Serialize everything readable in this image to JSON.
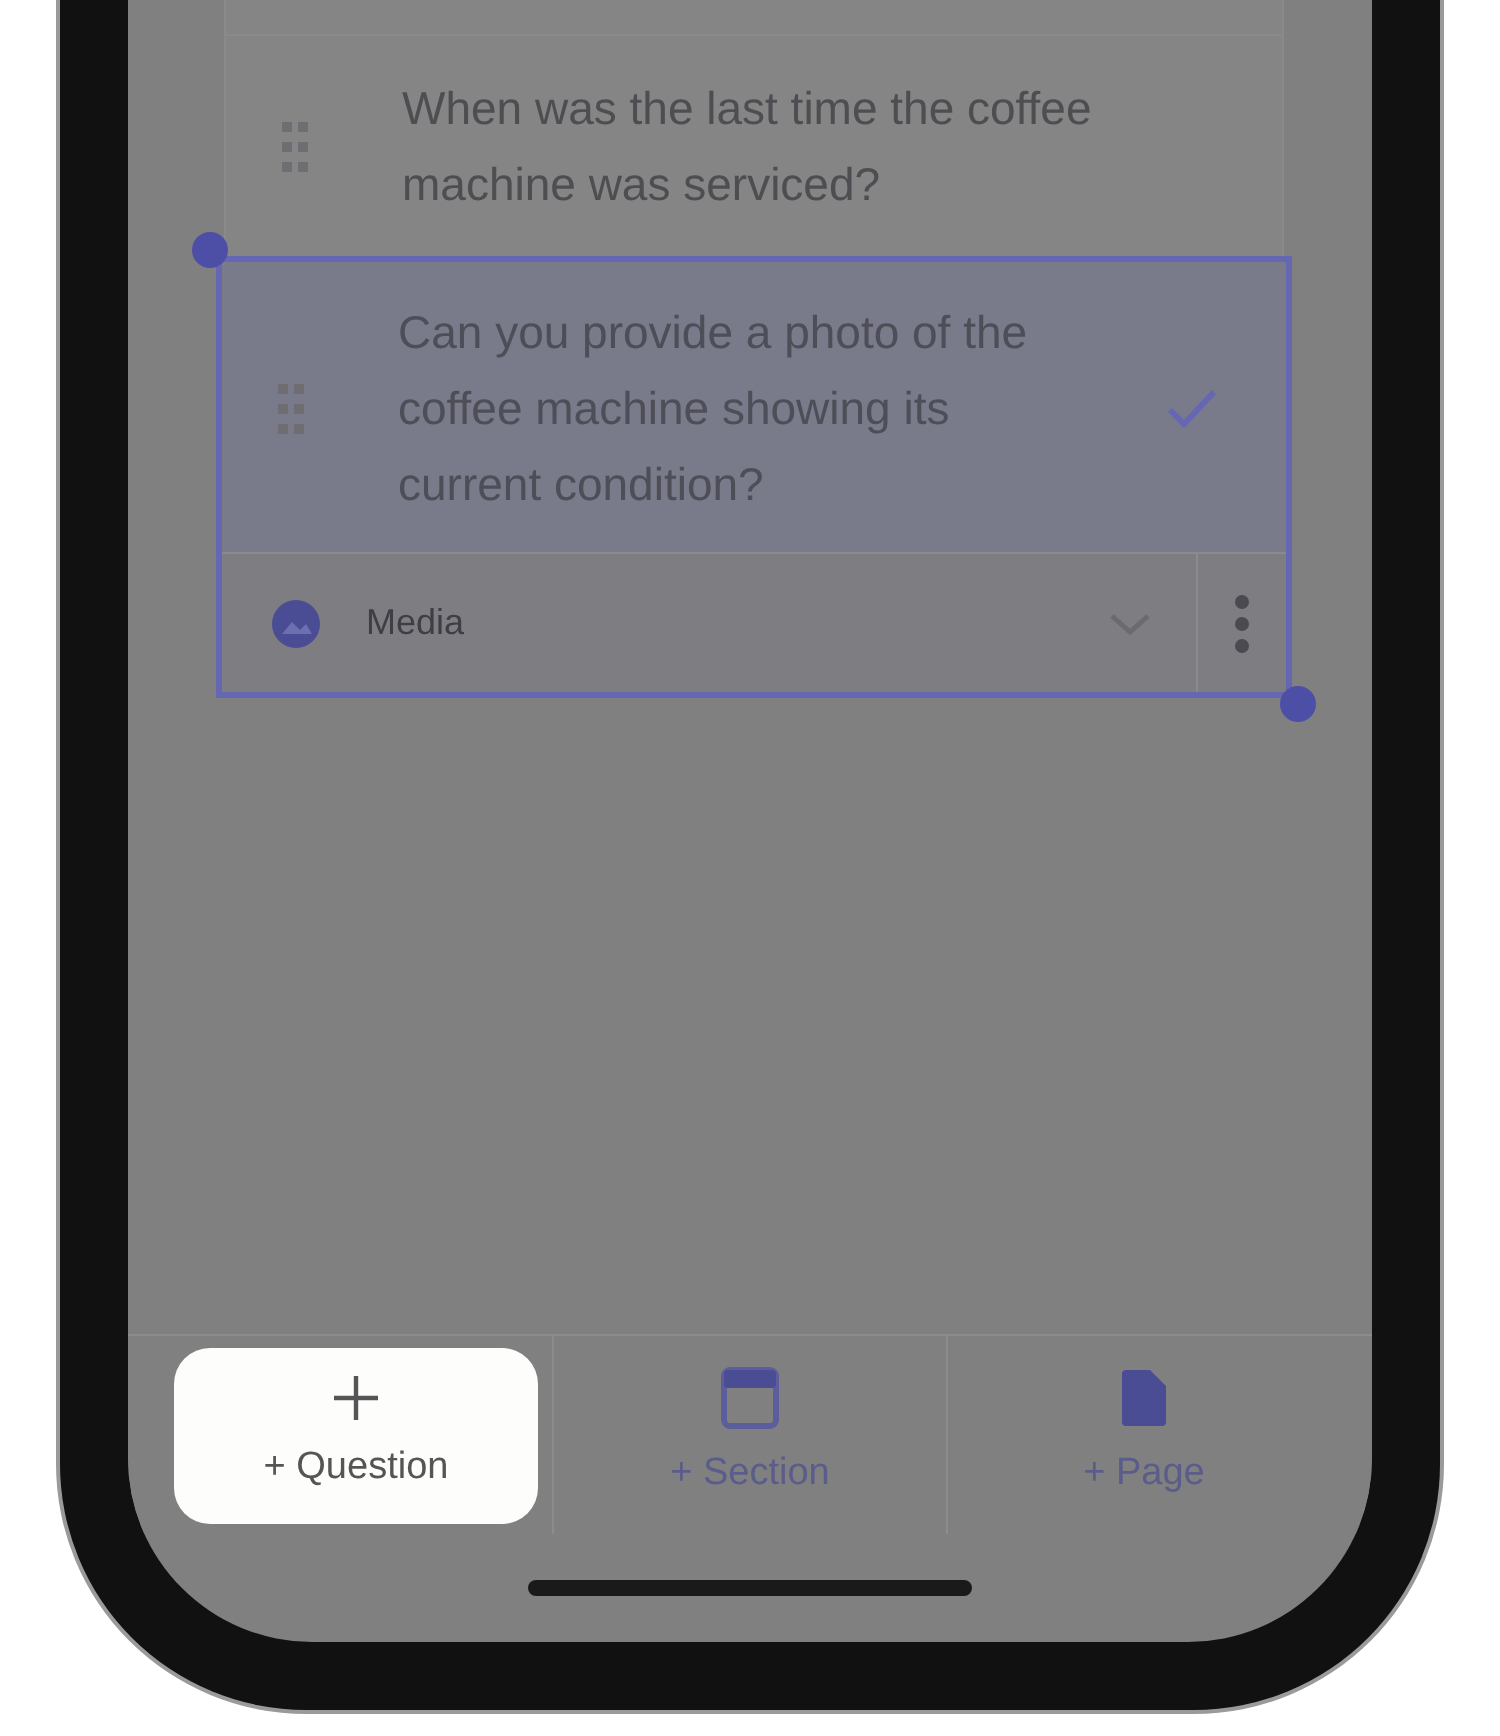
{
  "questions": [
    {
      "text": "When was the last time the coffee machine was serviced?",
      "selected": false
    },
    {
      "text": "Can you provide a photo of the coffee machine showing its current condition?",
      "selected": true,
      "answer_type": "Media"
    }
  ],
  "toolbar": [
    {
      "kind": "question",
      "label": "+ Question",
      "selected": true
    },
    {
      "kind": "section",
      "label": "+ Section",
      "selected": false
    },
    {
      "kind": "page",
      "label": "+ Page",
      "selected": false
    }
  ]
}
